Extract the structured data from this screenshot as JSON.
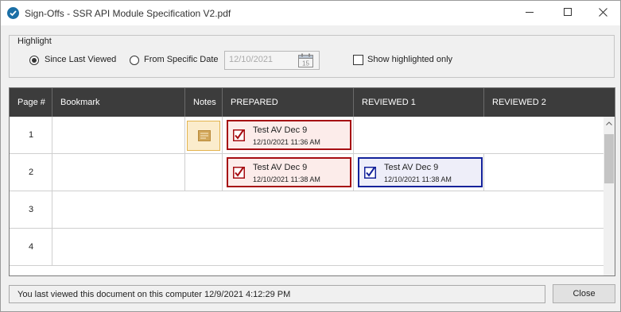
{
  "window": {
    "title": "Sign-Offs - SSR API Module Specification V2.pdf",
    "icon": "checkmark-circle-icon",
    "controls": [
      "minimize-icon",
      "maximize-icon",
      "close-icon"
    ]
  },
  "highlight": {
    "legend": "Highlight",
    "options": [
      {
        "label": "Since Last Viewed",
        "selected": true
      },
      {
        "label": "From Specific Date",
        "selected": false
      }
    ],
    "date_value": "12/10/2021",
    "calendar_icon_text": "15",
    "show_highlighted_only": {
      "label": "Show highlighted only",
      "checked": false
    }
  },
  "table": {
    "columns": [
      "Page #",
      "Bookmark",
      "Notes",
      "PREPARED",
      "REVIEWED 1",
      "REVIEWED 2"
    ],
    "rows": [
      {
        "page": "1",
        "has_note": true,
        "prepared": {
          "name": "Test AV Dec 9",
          "date": "12/10/2021 11:36 AM"
        }
      },
      {
        "page": "2",
        "has_note": false,
        "prepared": {
          "name": "Test AV Dec 9",
          "date": "12/10/2021 11:38 AM"
        },
        "reviewed1": {
          "name": "Test AV Dec 9",
          "date": "12/10/2021 11:38 AM"
        }
      },
      {
        "page": "3"
      },
      {
        "page": "4"
      }
    ]
  },
  "status_text": "You last viewed this document on this computer 12/9/2021 4:12:29 PM",
  "close_label": "Close",
  "colors": {
    "header_bg": "#3c3c3c",
    "prepared_border": "#a60d12",
    "reviewed_border": "#13229a",
    "note_border": "#e3b44e"
  }
}
